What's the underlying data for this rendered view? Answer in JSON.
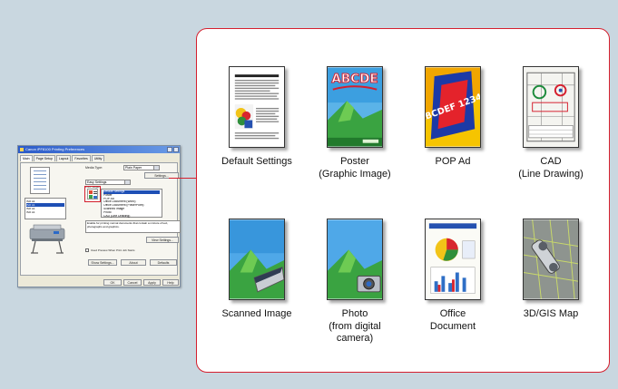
{
  "dialog": {
    "title": "Canon iPF8100 Printing Preferences",
    "tabs": [
      "Main",
      "Page Setup",
      "Layout",
      "Favorites",
      "Utility"
    ],
    "paper_sizes": [
      "ISO A1",
      "ISO A1",
      "ISO A1",
      "ISO A1"
    ],
    "media_type_label": "Media Type:",
    "media_type_value": "Plain Paper",
    "settings_button": "Settings...",
    "easy_settings_value": "Easy Settings",
    "print_target_label": "Print Target:",
    "print_targets": [
      "Default Settings",
      "Poster",
      "POP Ad",
      "Office Document (Word)",
      "Office Document (PowerPoint)",
      "Scanned Image",
      "Photo",
      "CAD (Line Drawing)",
      "CAD (Raster)",
      "GIS (Photograph and Line Drawing)"
    ],
    "description": "Enable for printing normal documents that contain a mixture of text, photographs and graphics.",
    "view_settings_button": "View Settings...",
    "preview_checkbox_label": "Used Preview When Print Job Starts",
    "show_settings_button": "Show Settings...",
    "about_button": "About",
    "defaults_button": "Defaults",
    "ok_button": "OK",
    "cancel_button": "Cancel",
    "apply_button": "Apply",
    "help_button": "Help"
  },
  "print_targets_panel": {
    "border_color": "#d51f2e",
    "items": [
      {
        "label": "Default Settings",
        "icon": "default-settings-thumbnail"
      },
      {
        "label": "Poster\n(Graphic Image)",
        "icon": "poster-thumbnail"
      },
      {
        "label": "POP Ad",
        "icon": "pop-ad-thumbnail"
      },
      {
        "label": "CAD\n(Line Drawing)",
        "icon": "cad-thumbnail"
      },
      {
        "label": "Scanned Image",
        "icon": "scanned-image-thumbnail"
      },
      {
        "label": "Photo\n(from digital\ncamera)",
        "icon": "photo-thumbnail"
      },
      {
        "label": "Office\nDocument",
        "icon": "office-document-thumbnail"
      },
      {
        "label": "3D/GIS Map",
        "icon": "gis-map-thumbnail"
      }
    ],
    "poster_text": "ABCDE",
    "pop_text": "ABCDEF 12345"
  }
}
